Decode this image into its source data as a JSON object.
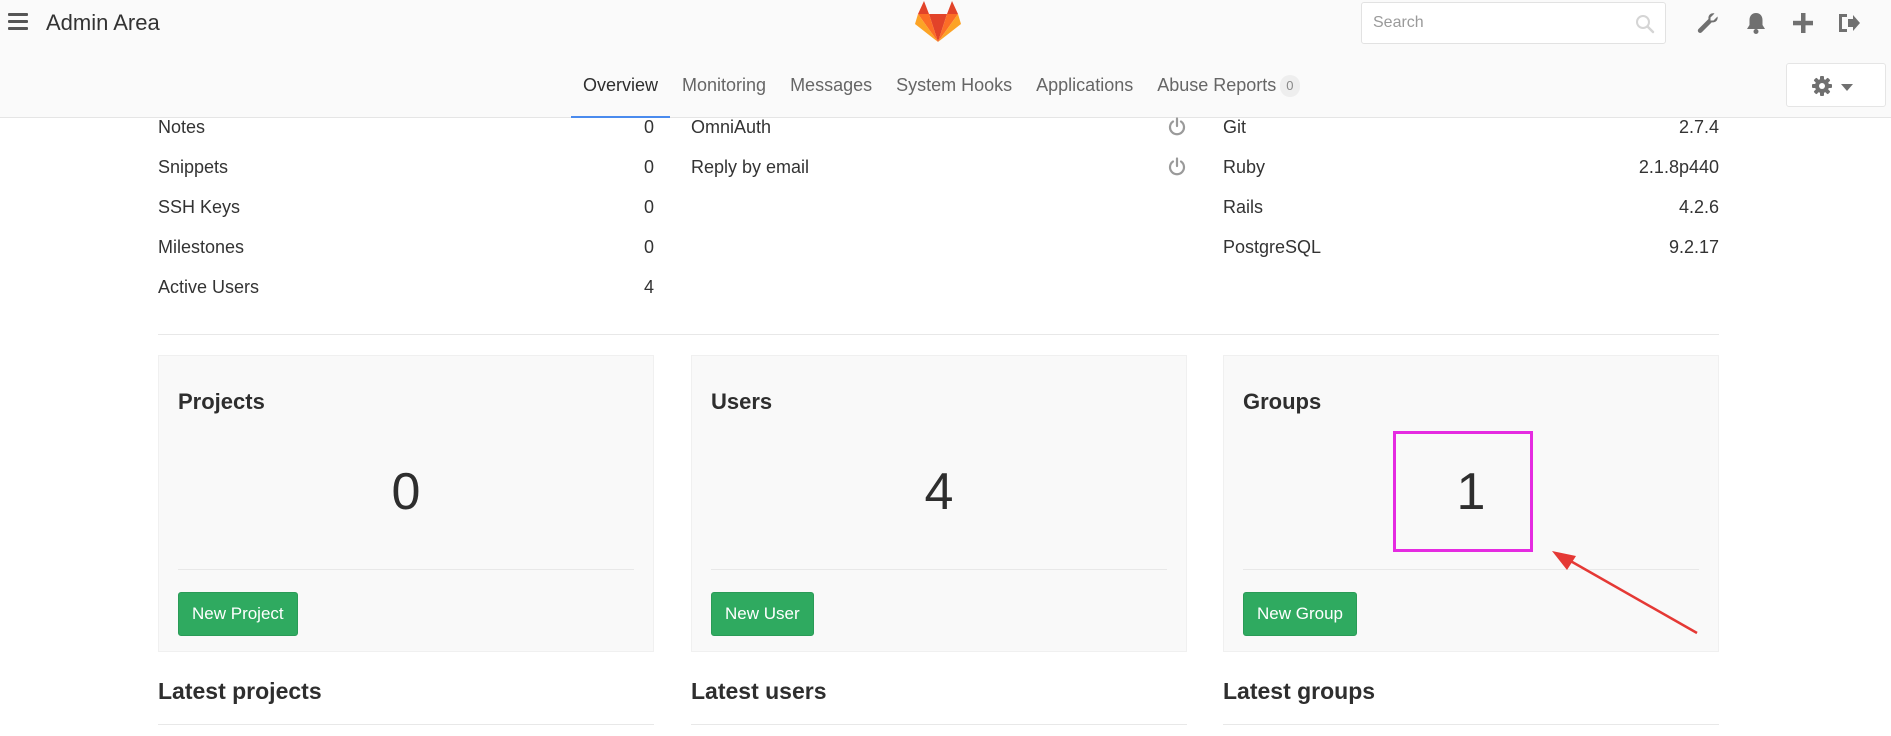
{
  "header": {
    "title": "Admin Area",
    "search_placeholder": "Search",
    "tabs": [
      {
        "label": "Overview"
      },
      {
        "label": "Monitoring"
      },
      {
        "label": "Messages"
      },
      {
        "label": "System Hooks"
      },
      {
        "label": "Applications"
      },
      {
        "label": "Abuse Reports",
        "badge": "0"
      }
    ],
    "icons": [
      "menu-icon",
      "gitlab-logo",
      "search-icon",
      "wrench-icon",
      "bell-icon",
      "plus-icon",
      "sign-out-icon",
      "gear-icon",
      "caret-down-icon"
    ]
  },
  "stats": {
    "counts": [
      {
        "label": "Notes",
        "value": "0"
      },
      {
        "label": "Snippets",
        "value": "0"
      },
      {
        "label": "SSH Keys",
        "value": "0"
      },
      {
        "label": "Milestones",
        "value": "0"
      },
      {
        "label": "Active Users",
        "value": "4"
      }
    ],
    "features": [
      {
        "label": "OmniAuth",
        "icon": "power-icon"
      },
      {
        "label": "Reply by email",
        "icon": "power-icon"
      }
    ],
    "components": [
      {
        "label": "Git",
        "value": "2.7.4"
      },
      {
        "label": "Ruby",
        "value": "2.1.8p440"
      },
      {
        "label": "Rails",
        "value": "4.2.6"
      },
      {
        "label": "PostgreSQL",
        "value": "9.2.17"
      }
    ]
  },
  "cards": [
    {
      "title": "Projects",
      "count": "0",
      "button": "New Project"
    },
    {
      "title": "Users",
      "count": "4",
      "button": "New User"
    },
    {
      "title": "Groups",
      "count": "1",
      "button": "New Group"
    }
  ],
  "latest": {
    "projects": "Latest projects",
    "users": "Latest users",
    "groups": "Latest groups"
  },
  "colors": {
    "accent_green": "#2faa60",
    "tab_underline": "#4a8bee",
    "annotation_box": "#e52be1",
    "annotation_arrow": "#e53935"
  }
}
